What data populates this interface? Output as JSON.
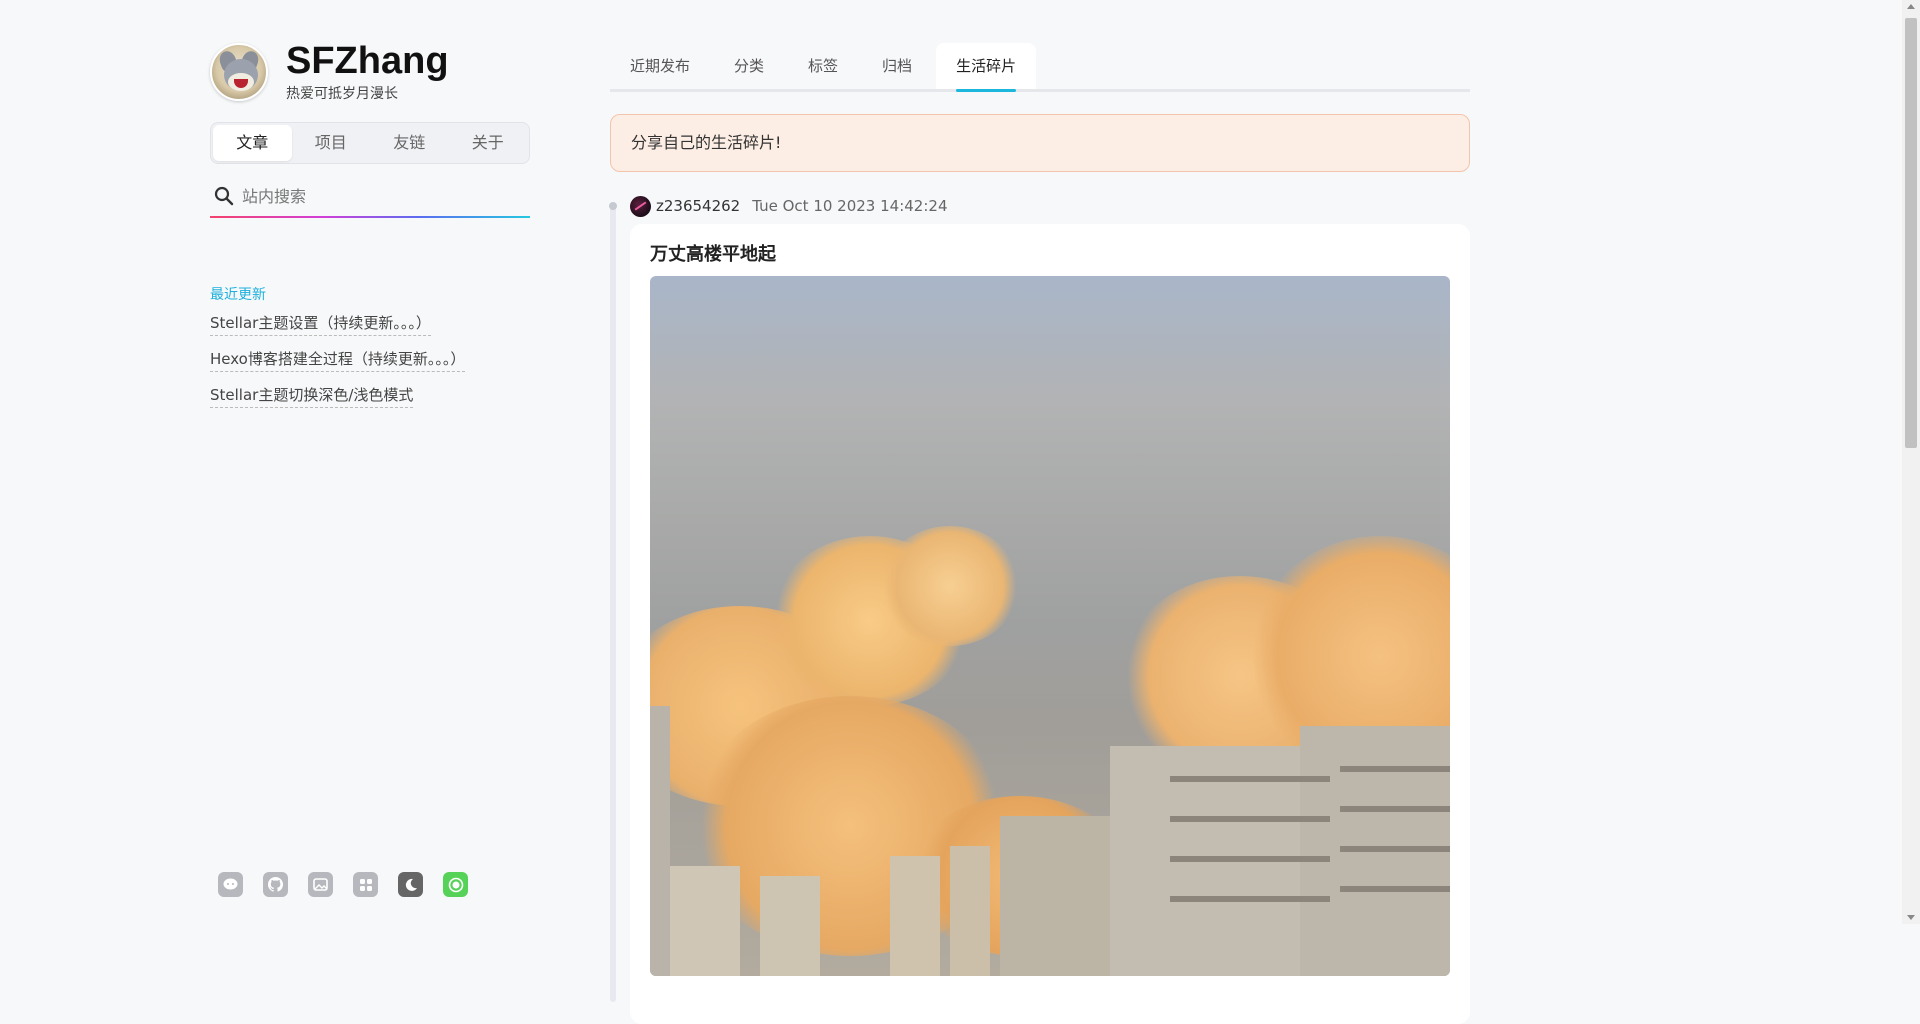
{
  "site": {
    "title": "SFZhang",
    "subtitle": "热爱可抵岁月漫长"
  },
  "main_nav": {
    "items": [
      "文章",
      "项目",
      "友链",
      "关于"
    ],
    "active_index": 0
  },
  "search": {
    "placeholder": "站内搜索",
    "value": ""
  },
  "recent": {
    "title": "最近更新",
    "items": [
      "Stellar主题设置（持续更新。。。）",
      "Hexo博客搭建全过程（持续更新。。。）",
      "Stellar主题切换深色/浅色模式"
    ]
  },
  "social": {
    "icons": [
      "chat-icon",
      "github-icon",
      "image-icon",
      "apps-icon",
      "moon-icon",
      "sun-icon"
    ]
  },
  "tabs": {
    "items": [
      "近期发布",
      "分类",
      "标签",
      "归档",
      "生活碎片"
    ],
    "active_index": 4
  },
  "notice": {
    "text": "分享自己的生活碎片!"
  },
  "post": {
    "username": "z23654262",
    "timestamp": "Tue Oct 10 2023 14:42:24",
    "title": "万丈高楼平地起"
  },
  "colors": {
    "accent": "#1bb7dc",
    "notice_bg": "#fdeee5",
    "notice_border": "#f2c4ab",
    "toggle_green": "#57d258"
  }
}
